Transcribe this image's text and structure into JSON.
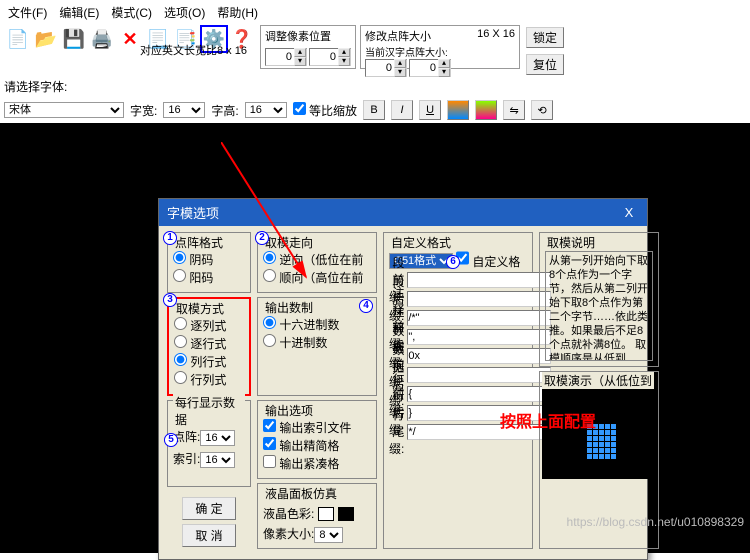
{
  "menu": {
    "file": "文件(F)",
    "edit": "编辑(E)",
    "mode": "模式(C)",
    "options": "选项(O)",
    "help": "帮助(H)"
  },
  "toolbar_note": "对应英文长宽比8 x 16",
  "group_pixel": {
    "title": "调整像素位置"
  },
  "group_matrix": {
    "title": "修改点阵大小",
    "sub": "当前汉字点阵大小:",
    "size": "16 X 16"
  },
  "lock_btn": "锁定",
  "reset_btn": "复位",
  "font_prompt": "请选择字体:",
  "font_name": "宋体",
  "char_width_label": "字宽:",
  "char_width": "16",
  "char_height_label": "字高:",
  "char_height": "16",
  "equal_scale": "等比缩放",
  "bold": "B",
  "italic": "I",
  "underline": "U",
  "dialog": {
    "title": "字模选项",
    "close": "X",
    "matrix_format": {
      "legend": "点阵格式",
      "opt1": "阴码",
      "opt2": "阳码"
    },
    "mode": {
      "legend": "取模方式",
      "opt1": "逐列式",
      "opt2": "逐行式",
      "opt3": "列行式",
      "opt4": "行列式"
    },
    "perline": {
      "legend": "每行显示数据",
      "label1": "点阵:",
      "val1": "16",
      "label2": "索引:",
      "val2": "16"
    },
    "direction": {
      "legend": "取模走向",
      "opt1": "逆向（低位在前",
      "opt2": "顺向（高位在前"
    },
    "radix": {
      "legend": "输出数制",
      "opt1": "十六进制数",
      "opt2": "十进制数"
    },
    "output": {
      "legend": "输出选项",
      "chk1": "输出索引文件",
      "chk2": "输出精简格",
      "chk3": "输出紧凑格"
    },
    "lcd": {
      "legend": "液晶面板仿真",
      "color_label": "液晶色彩:",
      "pixel_label": "像素大小:",
      "pixel_val": "8"
    },
    "custom": {
      "legend": "自定义格式",
      "combo": "C51格式",
      "chk": "自定义格",
      "rows": [
        {
          "label": "段前缀:",
          "val": ""
        },
        {
          "label": "段后缀:",
          "val": ""
        },
        {
          "label": "注释前缀:",
          "val": "/*\""
        },
        {
          "label": "注释后缀:",
          "val": "\","
        },
        {
          "label": "数据前缀:",
          "val": "0x"
        },
        {
          "label": "数据后缀:",
          "val": ""
        },
        {
          "label": "行前缀:",
          "val": "{"
        },
        {
          "label": "行后缀:",
          "val": "}"
        },
        {
          "label": "行尾缀:",
          "val": "*/"
        }
      ]
    },
    "desc": {
      "legend": "取模说明",
      "text": "从第一列开始向下取8个点作为一个字节，然后从第二列开始下取8个点作为第二个字节……依此类推。如果最后不足8个点就补满8位。\n取模顺序是从低到"
    },
    "preview": {
      "legend": "取模演示（从低位到"
    },
    "ok": "确 定",
    "cancel": "取 消"
  },
  "red_note": "按照上面配置",
  "watermark": "https://blog.csdn.net/u010898329",
  "badges": {
    "b1": "1",
    "b2": "2",
    "b3": "3",
    "b4": "4",
    "b5": "5",
    "b6": "6"
  }
}
